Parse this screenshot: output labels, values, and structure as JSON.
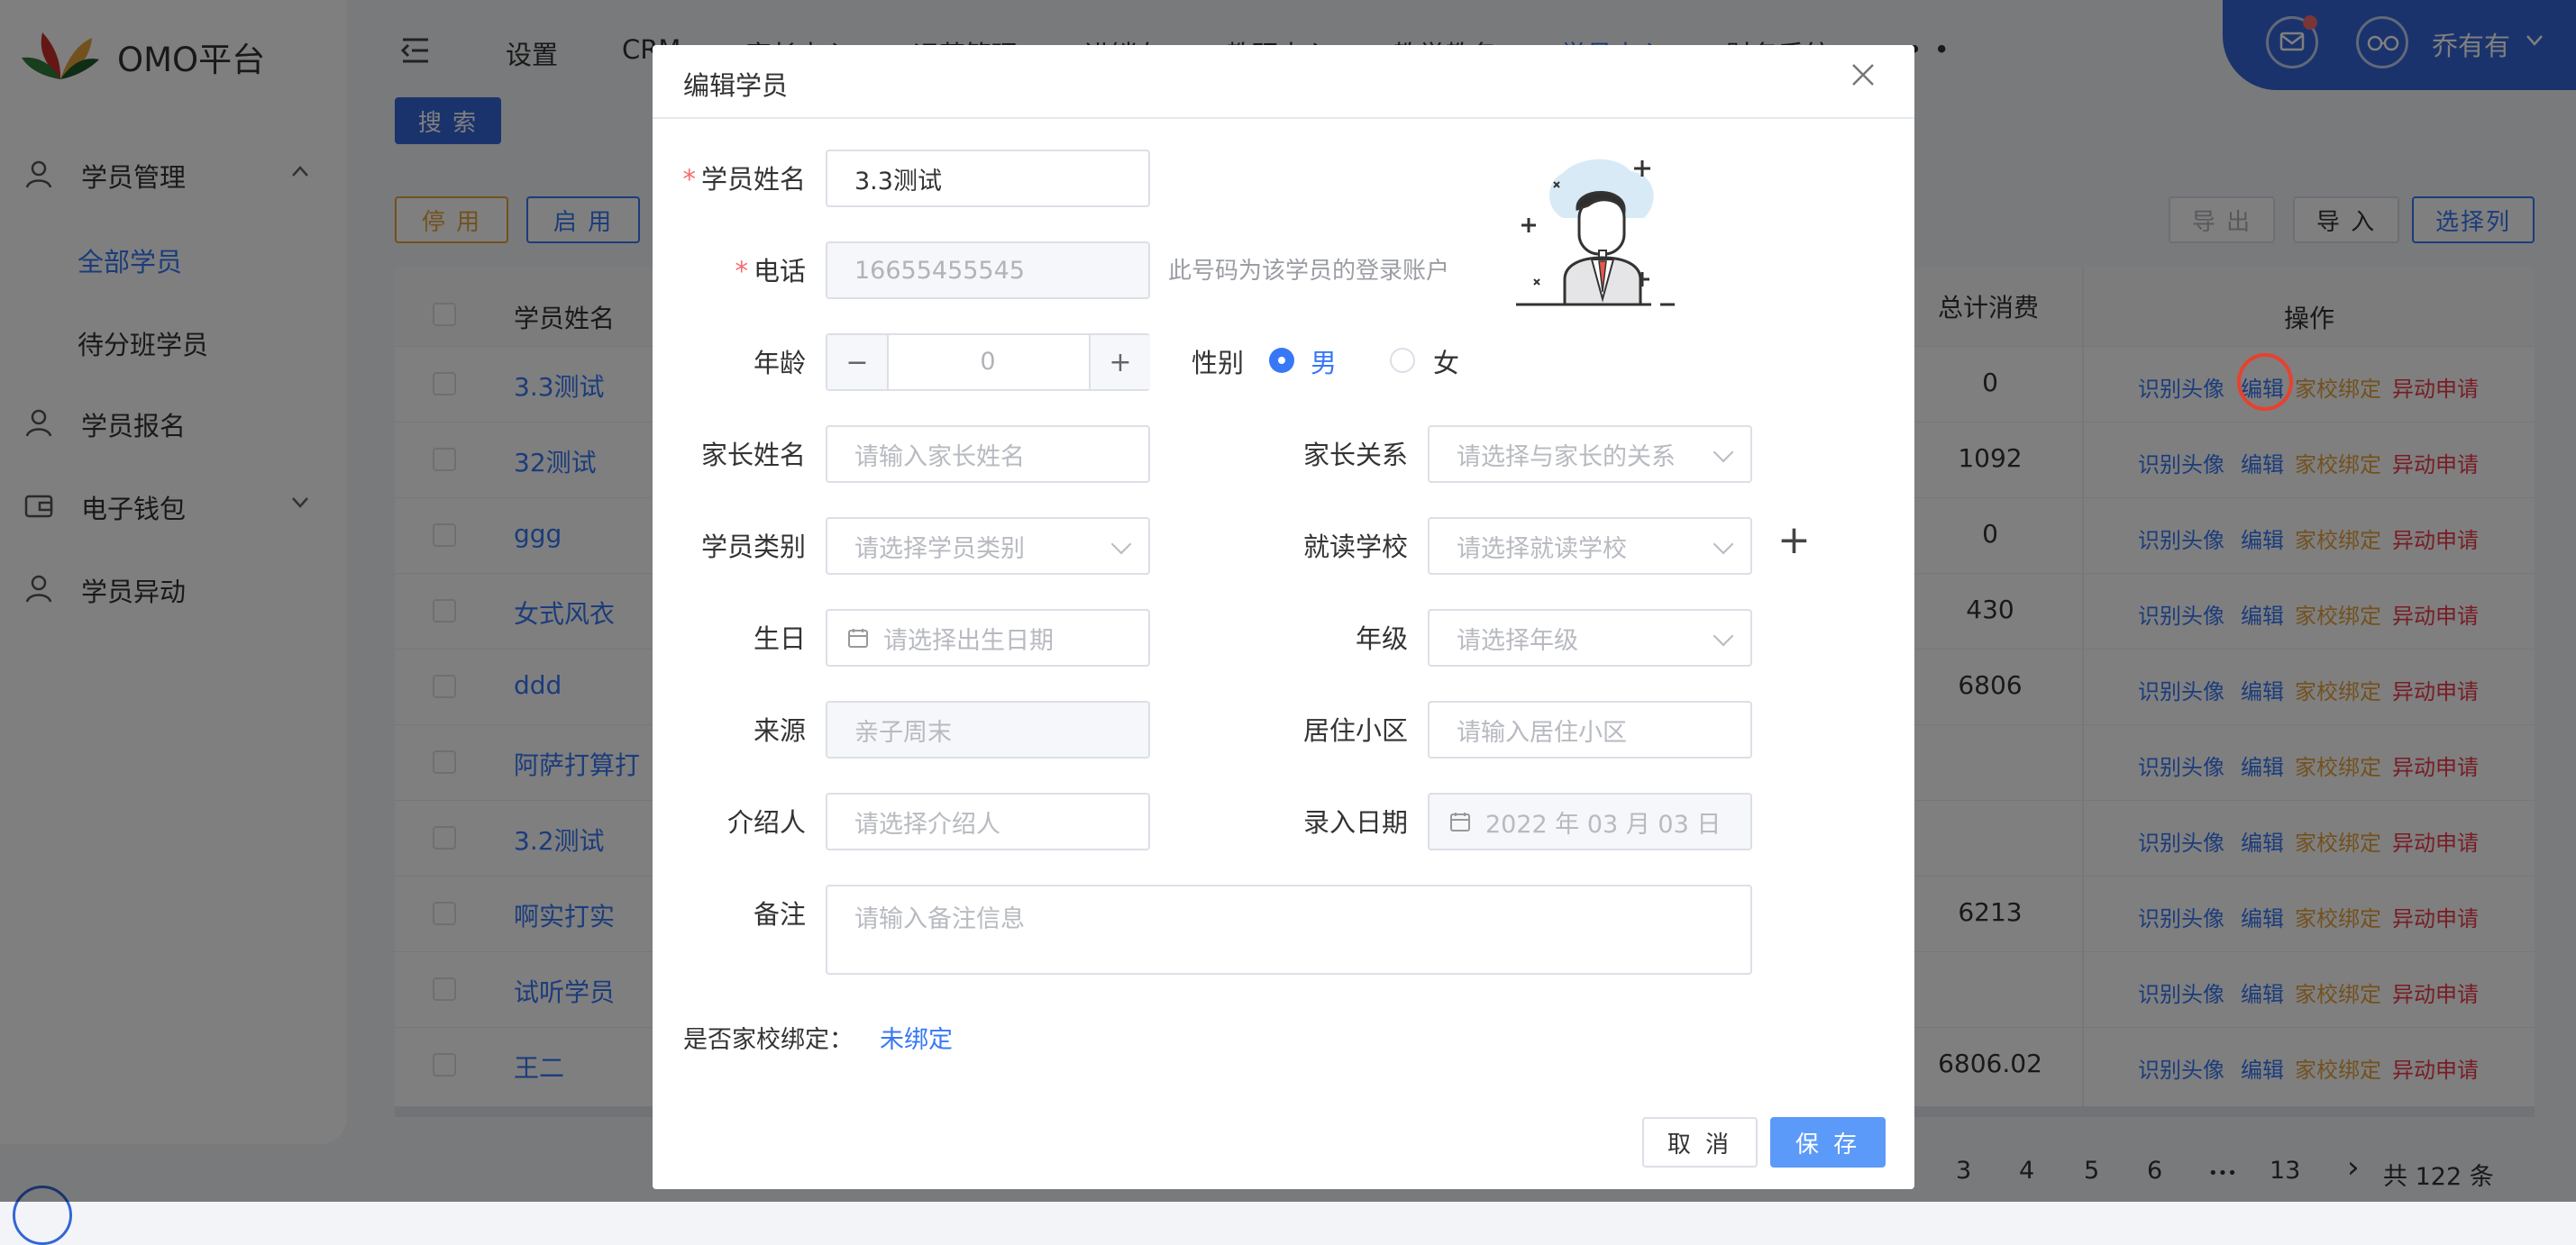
{
  "app": {
    "brand": "OMO平台"
  },
  "sidebar": {
    "groups": [
      {
        "label": "学员管理",
        "children": [
          {
            "label": "全部学员"
          },
          {
            "label": "待分班学员"
          }
        ]
      },
      {
        "label": "学员报名"
      },
      {
        "label": "电子钱包"
      },
      {
        "label": "学员异动"
      }
    ]
  },
  "topnav": {
    "items": [
      "设置",
      "CRM",
      "家长中心",
      "运营管理",
      "进销存",
      "教研中心",
      "教学教务",
      "学员中心",
      "财务系统"
    ],
    "more": "• • •",
    "user_name": "乔有有"
  },
  "toolbar": {
    "search_label": "搜 索",
    "disable_label": "停 用",
    "enable_label": "启 用",
    "export_label": "导 出",
    "import_label": "导 入",
    "select_columns_label": "选择列"
  },
  "table": {
    "headers": {
      "name": "学员姓名",
      "total": "总计消费",
      "ops": "操作"
    },
    "rows": [
      {
        "name": "3.3测试",
        "total": "0"
      },
      {
        "name": "32测试",
        "total": "1092"
      },
      {
        "name": "ggg",
        "total": "0"
      },
      {
        "name": "女式风衣",
        "total": "430"
      },
      {
        "name": "ddd",
        "total": "6806"
      },
      {
        "name": "阿萨打算打",
        "total": ""
      },
      {
        "name": "3.2测试",
        "total": ""
      },
      {
        "name": "啊实打实",
        "total": "6213"
      },
      {
        "name": "试听学员",
        "total": ""
      },
      {
        "name": "王二",
        "total": "6806.02"
      }
    ],
    "ops": {
      "recognize": "识别头像",
      "edit": "编辑",
      "bind": "家校绑定",
      "change": "异动申请"
    }
  },
  "pager": {
    "pages": [
      "3",
      "4",
      "5",
      "6",
      "•••",
      "13"
    ],
    "next": "›",
    "total": "共 122 条"
  },
  "modal": {
    "title": "编辑学员",
    "fields": {
      "student_name": {
        "label": "学员姓名",
        "value": "3.3测试"
      },
      "phone": {
        "label": "电话",
        "value": "16655455545",
        "hint": "此号码为该学员的登录账户"
      },
      "age": {
        "label": "年龄",
        "value": "0",
        "minus": "−",
        "plus": "+"
      },
      "gender": {
        "label": "性别",
        "male": "男",
        "female": "女",
        "selected": "男"
      },
      "parent_name": {
        "label": "家长姓名",
        "placeholder": "请输入家长姓名"
      },
      "parent_relation": {
        "label": "家长关系",
        "placeholder": "请选择与家长的关系"
      },
      "student_type": {
        "label": "学员类别",
        "placeholder": "请选择学员类别"
      },
      "school": {
        "label": "就读学校",
        "placeholder": "请选择就读学校",
        "add": "+"
      },
      "birthday": {
        "label": "生日",
        "placeholder": "请选择出生日期"
      },
      "grade": {
        "label": "年级",
        "placeholder": "请选择年级"
      },
      "source": {
        "label": "来源",
        "placeholder": "亲子周末"
      },
      "community": {
        "label": "居住小区",
        "placeholder": "请输入居住小区"
      },
      "referrer": {
        "label": "介绍人",
        "placeholder": "请选择介绍人"
      },
      "entry_date": {
        "label": "录入日期",
        "placeholder": "2022 年 03 月 03 日"
      },
      "remark": {
        "label": "备注",
        "placeholder": "请输入备注信息"
      }
    },
    "binding": {
      "label": "是否家校绑定：",
      "value": "未绑定"
    },
    "cancel_label": "取 消",
    "save_label": "保 存"
  },
  "colors": {
    "primary": "#3778f6",
    "orange": "#e6a23c",
    "red": "#f0384a",
    "nav_blue": "#3466d8"
  }
}
